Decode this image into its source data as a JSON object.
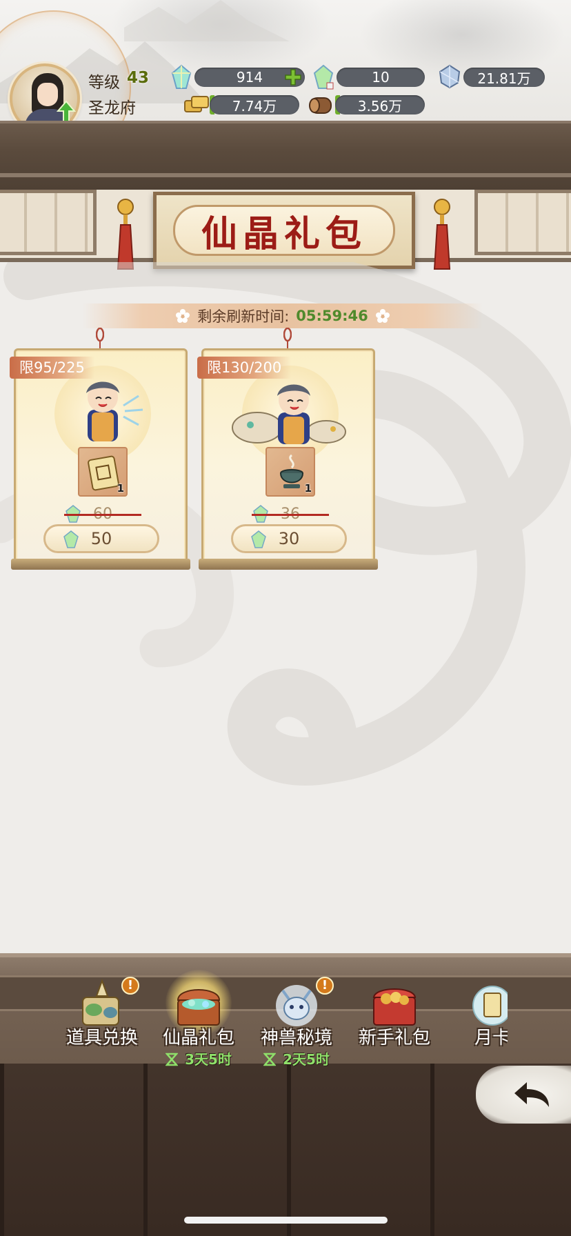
{
  "player": {
    "level_label": "等级",
    "level": "43",
    "residence": "圣龙府"
  },
  "resources": {
    "crystal": "914",
    "bound_crystal": "10",
    "spirit_stone": "21.81万",
    "gold": "7.74万",
    "wood": "3.56万"
  },
  "title": "仙晶礼包",
  "refresh": {
    "label": "剩余刷新时间:",
    "time": "05:59:46"
  },
  "packs": [
    {
      "limit": "限95/225",
      "item_count": "1",
      "old_price": "60",
      "price": "50"
    },
    {
      "limit": "限130/200",
      "item_count": "1",
      "old_price": "36",
      "price": "30"
    }
  ],
  "nav": {
    "items": [
      {
        "label": "道具兑换",
        "timer": ""
      },
      {
        "label": "仙晶礼包",
        "timer": "3天5时"
      },
      {
        "label": "神兽秘境",
        "timer": "2天5时"
      },
      {
        "label": "新手礼包",
        "timer": ""
      },
      {
        "label": "月卡",
        "timer": ""
      }
    ],
    "badge": "!"
  },
  "colors": {
    "title_red": "#9c1c16",
    "timer_green": "#4f8a2c",
    "level_green": "#5a6c0c",
    "card_cream": "#fbefc6"
  }
}
